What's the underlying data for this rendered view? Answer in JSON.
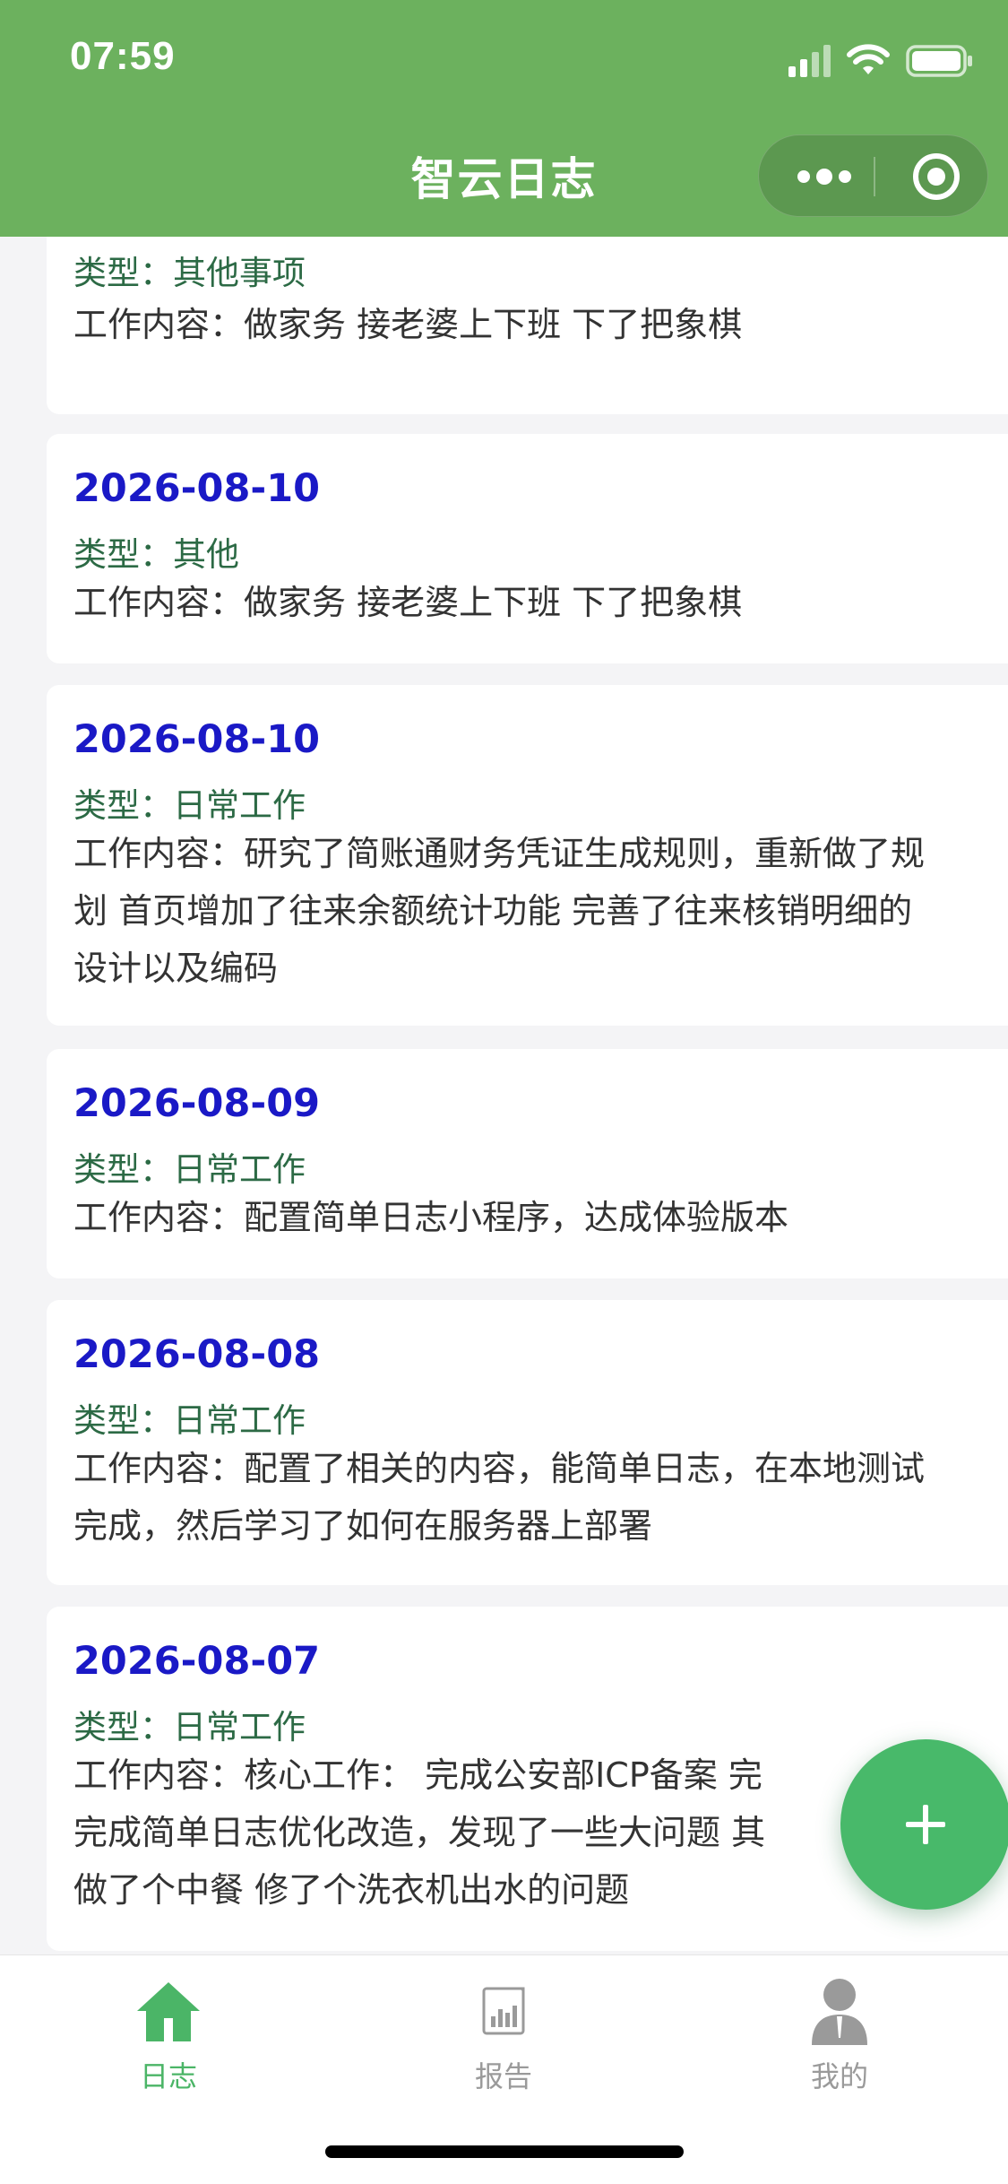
{
  "status_bar": {
    "time": "07:59"
  },
  "nav": {
    "title": "智云日志",
    "capsule_more_icon": "more-dots-icon",
    "capsule_close_icon": "record-target-icon"
  },
  "logs": [
    {
      "type_prefix": "类型：",
      "type": "其他事项",
      "content_prefix": "工作内容：",
      "content_lines": [
        "做家务 接老婆上下班 下了把象棋"
      ]
    },
    {
      "date": "2026-08-10",
      "type_prefix": "类型：",
      "type": "其他",
      "content_prefix": "工作内容：",
      "content_lines": [
        "做家务 接老婆上下班 下了把象棋"
      ]
    },
    {
      "date": "2026-08-10",
      "type_prefix": "类型：",
      "type": "日常工作",
      "content_prefix": "工作内容：",
      "content_lines": [
        "研究了简账通财务凭证生成规则，重新做了规",
        "划 首页增加了往来余额统计功能 完善了往来核销明细的",
        "设计以及编码"
      ]
    },
    {
      "date": "2026-08-09",
      "type_prefix": "类型：",
      "type": "日常工作",
      "content_prefix": "工作内容：",
      "content_lines": [
        "配置简单日志小程序，达成体验版本"
      ]
    },
    {
      "date": "2026-08-08",
      "type_prefix": "类型：",
      "type": "日常工作",
      "content_prefix": "工作内容：",
      "content_lines": [
        "配置了相关的内容，能简单日志，在本地测试",
        "完成，然后学习了如何在服务器上部署"
      ]
    },
    {
      "date": "2026-08-07",
      "type_prefix": "类型：",
      "type": "日常工作",
      "content_prefix": "工作内容：",
      "content_lines": [
        "核心工作： 完成公安部ICP备案 完",
        "完成简单日志优化改造，发现了一些大问题 其",
        "做了个中餐 修了个洗衣机出水的问题"
      ]
    }
  ],
  "fab": {
    "icon": "plus-icon"
  },
  "tabs": [
    {
      "label": "日志",
      "icon": "home-icon",
      "active": true
    },
    {
      "label": "报告",
      "icon": "report-chart-icon",
      "active": false
    },
    {
      "label": "我的",
      "icon": "user-icon",
      "active": false
    }
  ],
  "colors": {
    "header": "#6cb15e",
    "date": "#1a19c6",
    "type": "#2c6a45",
    "fab": "#48b96a",
    "tab_active": "#4bb567",
    "tab_inactive": "#9a9a9a",
    "background": "#f4f4f6"
  }
}
